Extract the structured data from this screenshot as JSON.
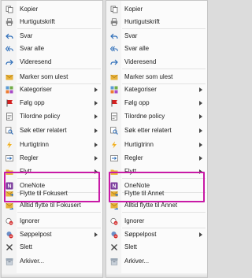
{
  "menus": [
    {
      "items": [
        {
          "label": "Kopier",
          "icon": "copy-icon",
          "submenu": false
        },
        {
          "label": "Hurtigutskrift",
          "icon": "print-icon",
          "submenu": false
        },
        {
          "label": "Svar",
          "icon": "reply-icon",
          "submenu": false
        },
        {
          "label": "Svar alle",
          "icon": "reply-all-icon",
          "submenu": false
        },
        {
          "label": "Videresend",
          "icon": "forward-icon",
          "submenu": false
        },
        {
          "label": "Marker som ulest",
          "icon": "envelope-icon",
          "submenu": false
        },
        {
          "label": "Kategoriser",
          "icon": "categorize-icon",
          "submenu": true
        },
        {
          "label": "Følg opp",
          "icon": "flag-icon",
          "submenu": true
        },
        {
          "label": "Tilordne policy",
          "icon": "policy-icon",
          "submenu": true
        },
        {
          "label": "Søk etter relatert",
          "icon": "search-related-icon",
          "submenu": true
        },
        {
          "label": "Hurtigtrinn",
          "icon": "lightning-icon",
          "submenu": true
        },
        {
          "label": "Regler",
          "icon": "rules-icon",
          "submenu": true
        },
        {
          "label": "Flytt",
          "icon": "move-folder-icon",
          "submenu": true
        },
        {
          "label": "OneNote",
          "icon": "onenote-icon",
          "submenu": false
        },
        {
          "label": "Flytte til Fokusert",
          "icon": "move-focused-icon",
          "submenu": false
        },
        {
          "label": "Alltid flytte til Fokusert",
          "icon": "always-move-focused-icon",
          "submenu": false
        },
        {
          "label": "Ignorer",
          "icon": "ignore-icon",
          "submenu": false
        },
        {
          "label": "Søppelpost",
          "icon": "junk-icon",
          "submenu": true
        },
        {
          "label": "Slett",
          "icon": "delete-icon",
          "submenu": false
        },
        {
          "label": "Arkiver...",
          "icon": "archive-icon",
          "submenu": false
        }
      ]
    },
    {
      "items": [
        {
          "label": "Kopier",
          "icon": "copy-icon",
          "submenu": false
        },
        {
          "label": "Hurtigutskrift",
          "icon": "print-icon",
          "submenu": false
        },
        {
          "label": "Svar",
          "icon": "reply-icon",
          "submenu": false
        },
        {
          "label": "Svar alle",
          "icon": "reply-all-icon",
          "submenu": false
        },
        {
          "label": "Videresend",
          "icon": "forward-icon",
          "submenu": false
        },
        {
          "label": "Marker som ulest",
          "icon": "envelope-icon",
          "submenu": false
        },
        {
          "label": "Kategoriser",
          "icon": "categorize-icon",
          "submenu": true
        },
        {
          "label": "Følg opp",
          "icon": "flag-icon",
          "submenu": true
        },
        {
          "label": "Tilordne policy",
          "icon": "policy-icon",
          "submenu": true
        },
        {
          "label": "Søk etter relatert",
          "icon": "search-related-icon",
          "submenu": true
        },
        {
          "label": "Hurtigtrinn",
          "icon": "lightning-icon",
          "submenu": true
        },
        {
          "label": "Regler",
          "icon": "rules-icon",
          "submenu": true
        },
        {
          "label": "Flytt",
          "icon": "move-folder-icon",
          "submenu": true
        },
        {
          "label": "OneNote",
          "icon": "onenote-icon",
          "submenu": false
        },
        {
          "label": "Flytte til Annet",
          "icon": "move-other-icon",
          "submenu": false
        },
        {
          "label": "Alltid flytte til Annet",
          "icon": "always-move-other-icon",
          "submenu": false
        },
        {
          "label": "Ignorer",
          "icon": "ignore-icon",
          "submenu": false
        },
        {
          "label": "Søppelpost",
          "icon": "junk-icon",
          "submenu": true
        },
        {
          "label": "Slett",
          "icon": "delete-icon",
          "submenu": false
        },
        {
          "label": "Arkiver...",
          "icon": "archive-icon",
          "submenu": false
        }
      ]
    }
  ],
  "colors": {
    "highlight": "#c81aa6",
    "accent_blue": "#2b6cb8",
    "flag_red": "#d32020",
    "envelope_yellow": "#e8b23a",
    "onenote_purple": "#7a3b9c"
  }
}
